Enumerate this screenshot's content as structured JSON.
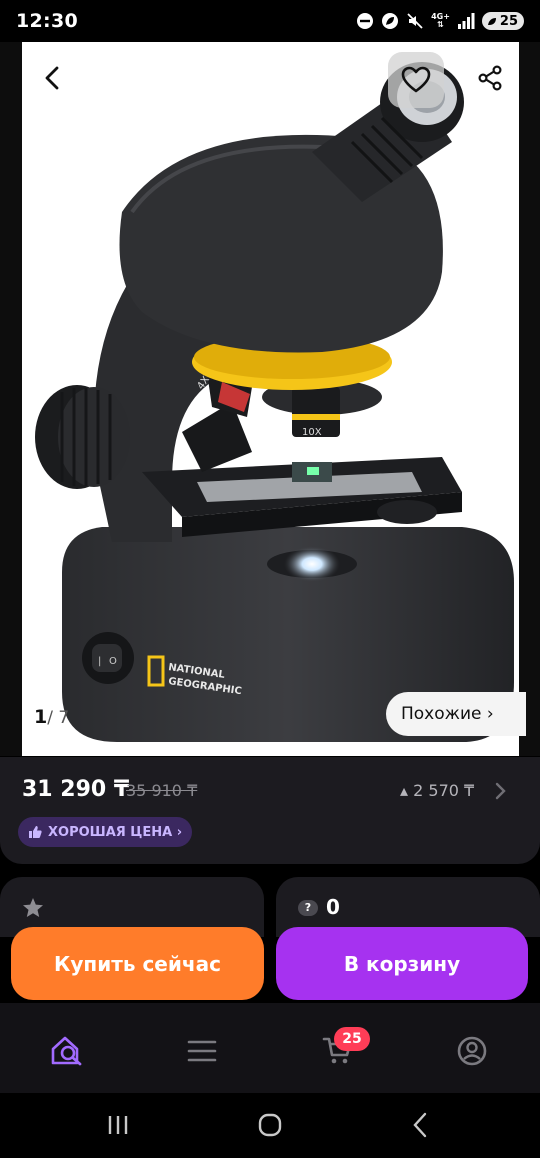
{
  "status_bar": {
    "time": "12:30",
    "network": "4G+",
    "battery": "25",
    "icons": [
      "dnd-icon",
      "leaf-icon",
      "mute-icon",
      "network-icon",
      "signal-icon",
      "battery-icon"
    ]
  },
  "gallery": {
    "current": "1",
    "total": "/ 7",
    "similar_label": "Похожие ›",
    "image": "microscope-product-image",
    "image_text": {
      "lens_left": "4X",
      "lens_right": "10X",
      "brand_line1": "NATIONAL",
      "brand_line2": "GEOGRAPHIC"
    }
  },
  "product": {
    "price": "31 290 ₸",
    "old_price": "35 910 ₸",
    "installment": "▴ 2 570 ₸",
    "good_price_badge": "ХОРОШАЯ ЦЕНА ›"
  },
  "info": {
    "questions_count": "0"
  },
  "actions": {
    "buy_now": "Купить сейчас",
    "add_to_cart": "В корзину"
  },
  "bottom_nav": {
    "cart_badge": "25",
    "items": [
      "home-search-icon",
      "catalog-icon",
      "cart-icon",
      "profile-icon"
    ]
  },
  "colors": {
    "buy": "#ff7c2a",
    "cart": "#a632f0",
    "badge": "#ff3d57",
    "good_price_bg": "#3b2860",
    "accent": "#a26bff"
  }
}
